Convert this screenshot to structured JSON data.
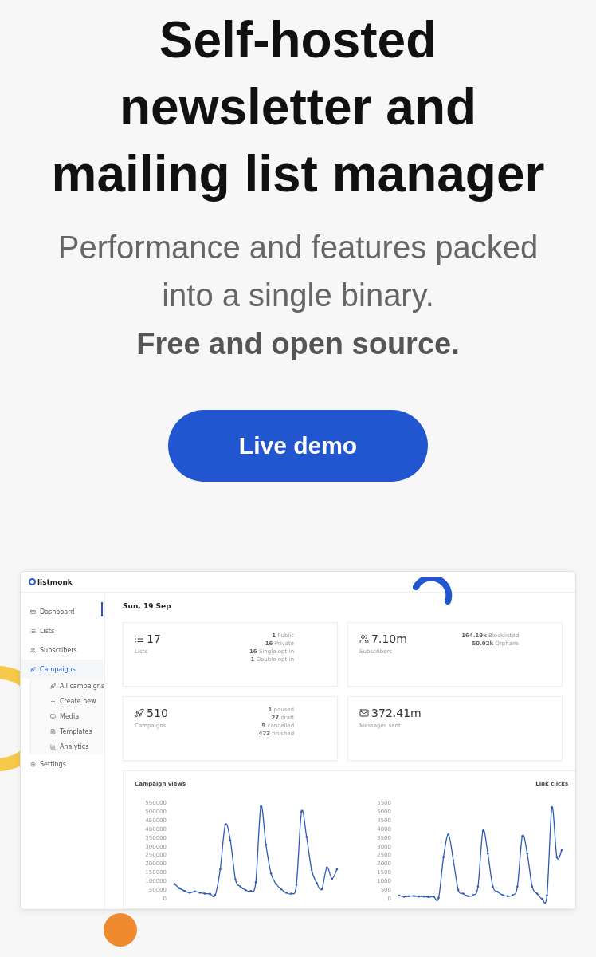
{
  "hero": {
    "title": "Self-hosted newsletter and mailing list manager",
    "subtitle": "Performance and features packed into a single binary.",
    "tagline": "Free and open source.",
    "button": "Live demo"
  },
  "app": {
    "logo": "listmonk",
    "date": "Sun, 19 Sep",
    "sidebar": [
      {
        "label": "Dashboard",
        "selected": false
      },
      {
        "label": "Lists",
        "selected": false
      },
      {
        "label": "Subscribers",
        "selected": false
      },
      {
        "label": "Campaigns",
        "selected": true,
        "children": [
          {
            "label": "All campaigns",
            "selected": false
          },
          {
            "label": "Create new",
            "selected": false
          },
          {
            "label": "Media",
            "selected": false
          },
          {
            "label": "Templates",
            "selected": false
          },
          {
            "label": "Analytics",
            "selected": false
          }
        ]
      },
      {
        "label": "Settings",
        "selected": false
      }
    ],
    "stats": [
      {
        "value": "17",
        "label": "Lists",
        "breakdown": [
          {
            "count": "1",
            "label": "Public"
          },
          {
            "count": "16",
            "label": "Private"
          },
          {
            "count": "16",
            "label": "Single opt-in"
          },
          {
            "count": "1",
            "label": "Double opt-in"
          }
        ]
      },
      {
        "value": "7.10m",
        "label": "Subscribers",
        "breakdown": [
          {
            "count": "164.19k",
            "label": "Blocklisted"
          },
          {
            "count": "50.02k",
            "label": "Orphans"
          }
        ]
      },
      {
        "value": "510",
        "label": "Campaigns",
        "breakdown": [
          {
            "count": "1",
            "label": "paused"
          },
          {
            "count": "27",
            "label": "draft"
          },
          {
            "count": "9",
            "label": "cancelled"
          },
          {
            "count": "473",
            "label": "finished"
          }
        ]
      },
      {
        "value": "372.41m",
        "label": "Messages sent"
      }
    ],
    "charts": [
      {
        "title": "Campaign views",
        "chart_data": {
          "type": "line",
          "ylim": [
            0,
            550000
          ],
          "yticks": [
            0,
            50000,
            100000,
            150000,
            200000,
            250000,
            300000,
            350000,
            400000,
            450000,
            500000,
            550000
          ],
          "series": [
            {
              "color": "#2d5bb8",
              "values": [
                85000,
                60000,
                45000,
                35000,
                42000,
                35000,
                30000,
                28000,
                20000,
                170000,
                425000,
                335000,
                110000,
                70000,
                50000,
                45000,
                95000,
                530000,
                310000,
                145000,
                85000,
                55000,
                35000,
                30000,
                80000,
                500000,
                355000,
                165000,
                90000,
                55000,
                180000,
                115000,
                170000
              ]
            }
          ]
        }
      },
      {
        "title": "Link clicks",
        "chart_data": {
          "type": "line",
          "ylim": [
            0,
            5500
          ],
          "yticks": [
            0,
            500,
            1000,
            1500,
            2000,
            2500,
            3000,
            3500,
            4000,
            4500,
            5000,
            5500
          ],
          "series": [
            {
              "color": "#2d5bb8",
              "values": [
                180,
                120,
                150,
                160,
                130,
                130,
                100,
                120,
                50,
                2400,
                3700,
                2200,
                500,
                300,
                150,
                200,
                700,
                3900,
                2600,
                700,
                400,
                200,
                150,
                200,
                700,
                3600,
                2600,
                700,
                300,
                0,
                200,
                5250,
                2400,
                2800
              ]
            }
          ]
        }
      }
    ]
  }
}
